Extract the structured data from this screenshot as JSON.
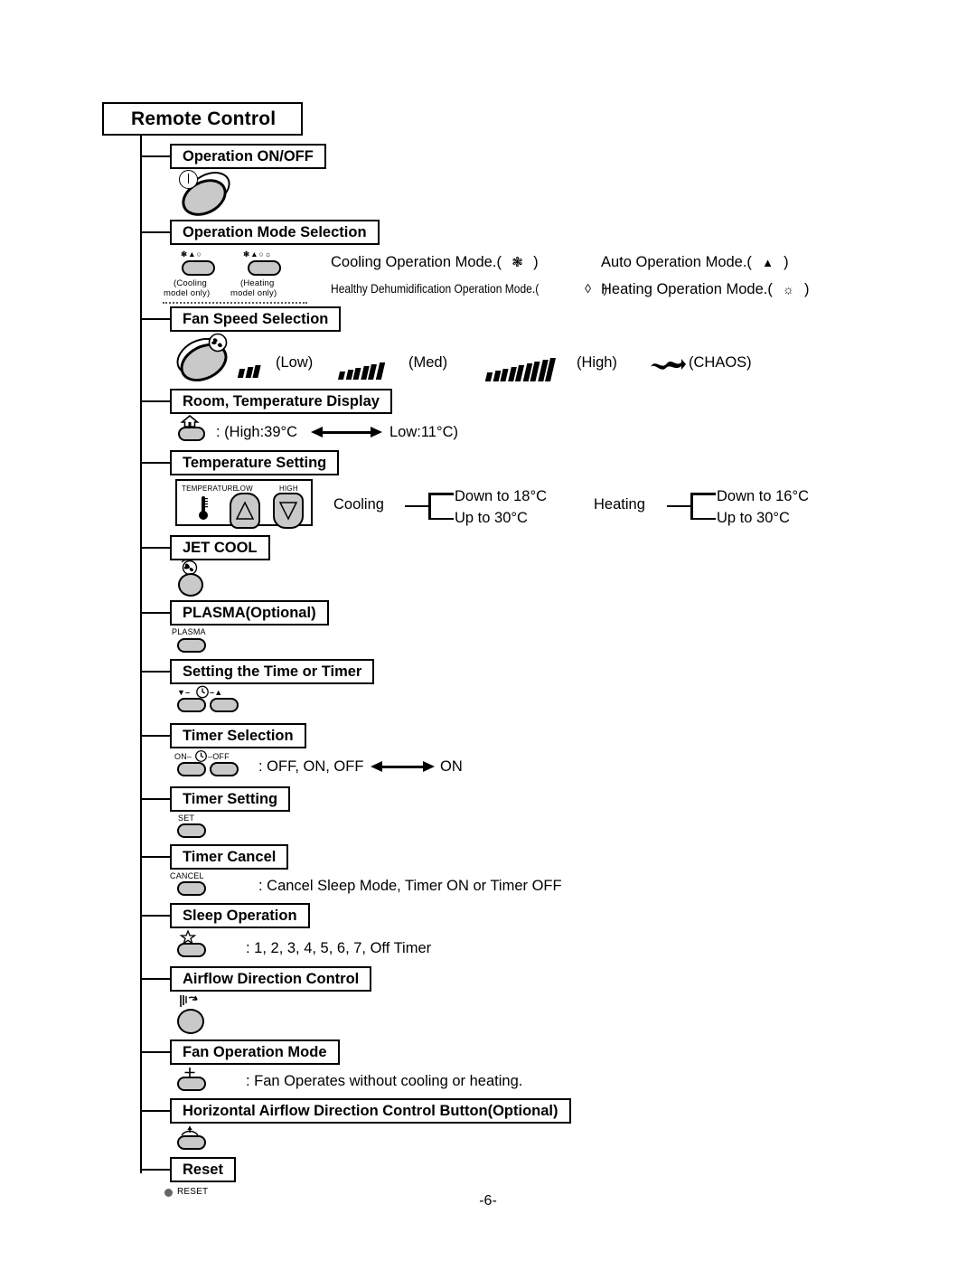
{
  "document": {
    "title": "Remote Control",
    "page_number": "-6-"
  },
  "sections": [
    {
      "id": "operation-on-off",
      "label": "Operation ON/OFF",
      "button_icon": "power-button-icon"
    },
    {
      "id": "operation-mode-selection",
      "label": "Operation Mode Selection",
      "buttons": [
        {
          "symbols": "❄▲○",
          "caption_line1": "(Cooling",
          "caption_line2": "model only)"
        },
        {
          "symbols": "❄▲○☼",
          "caption_line1": "(Heating",
          "caption_line2": "model only)"
        }
      ],
      "modes": [
        {
          "text": "Cooling Operation Mode.(",
          "symbol": "❃",
          "close": ")"
        },
        {
          "text": "Auto Operation Mode.(",
          "symbol": "▲",
          "close": ")"
        },
        {
          "text": "Healthy Dehumidification Operation Mode.(",
          "symbol": "◊",
          "close": ")"
        },
        {
          "text": "Heating Operation Mode.(",
          "symbol": "☼",
          "close": ")"
        }
      ]
    },
    {
      "id": "fan-speed-selection",
      "label": "Fan Speed Selection",
      "speeds": [
        {
          "name": "(Low)",
          "bars": 3
        },
        {
          "name": "(Med)",
          "bars": 6
        },
        {
          "name": "(High)",
          "bars": 9
        },
        {
          "name": "(CHAOS)",
          "bars": 0
        }
      ]
    },
    {
      "id": "room-temperature-display",
      "label": "Room, Temperature Display",
      "range_prefix": ": (High:39°C",
      "range_suffix": "Low:11°C)"
    },
    {
      "id": "temperature-setting",
      "label": "Temperature Setting",
      "panel": {
        "title": "TEMPERATURE",
        "low_label": "LOW",
        "high_label": "HIGH"
      },
      "ranges": [
        {
          "mode": "Cooling",
          "down": "Down to 18°C",
          "up": "Up to 30°C"
        },
        {
          "mode": "Heating",
          "down": "Down to 16°C",
          "up": "Up to 30°C"
        }
      ]
    },
    {
      "id": "jet-cool",
      "label": "JET COOL",
      "button_icon": "jet-cool-fan-icon"
    },
    {
      "id": "plasma",
      "label": "PLASMA(Optional)",
      "button_caption": "PLASMA"
    },
    {
      "id": "setting-time-or-timer",
      "label": "Setting the Time or Timer",
      "button_caption_left": "▼–",
      "button_caption_right": "–▲",
      "clock_icon": "clock-icon"
    },
    {
      "id": "timer-selection",
      "label": "Timer Selection",
      "button_caption_left": "ON–",
      "button_caption_right": "–OFF",
      "description_prefix": ": OFF, ON, OFF",
      "description_suffix": "ON"
    },
    {
      "id": "timer-setting",
      "label": "Timer Setting",
      "button_caption": "SET"
    },
    {
      "id": "timer-cancel",
      "label": "Timer Cancel",
      "button_caption": "CANCEL",
      "description": ": Cancel Sleep Mode, Timer ON or Timer OFF"
    },
    {
      "id": "sleep-operation",
      "label": "Sleep Operation",
      "button_icon": "star-icon",
      "description": ": 1, 2, 3, 4, 5, 6, 7,  Off Timer"
    },
    {
      "id": "airflow-direction-control",
      "label": "Airflow Direction Control",
      "button_icon": "airflow-swing-icon"
    },
    {
      "id": "fan-operation-mode",
      "label": "Fan Operation Mode",
      "button_icon": "fan-plus-icon",
      "description": ": Fan Operates without cooling or heating."
    },
    {
      "id": "horizontal-airflow-direction-control",
      "label": "Horizontal Airflow Direction Control Button(Optional)",
      "button_icon": "horizontal-swing-icon"
    },
    {
      "id": "reset",
      "label": "Reset",
      "button_caption": "RESET"
    }
  ]
}
